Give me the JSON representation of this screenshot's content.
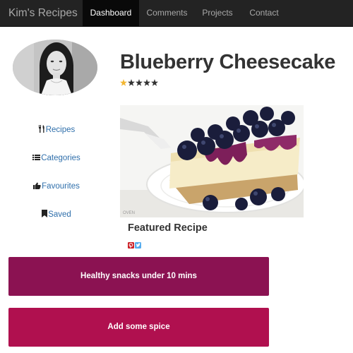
{
  "nav": {
    "brand": "Kim's Recipes",
    "items": [
      {
        "label": "Dashboard",
        "active": true
      },
      {
        "label": "Comments",
        "active": false
      },
      {
        "label": "Projects",
        "active": false
      },
      {
        "label": "Contact",
        "active": false
      }
    ]
  },
  "recipe": {
    "title": "Blueberry Cheesecake",
    "rating": 1,
    "rating_max": 5,
    "featured_label": "Featured Recipe",
    "watermark": "OVEN"
  },
  "sidebar": {
    "items": [
      {
        "label": "Recipes",
        "icon": "cutlery-icon"
      },
      {
        "label": "Categories",
        "icon": "list-icon"
      },
      {
        "label": "Favourites",
        "icon": "thumbs-up-icon"
      },
      {
        "label": "Saved",
        "icon": "bookmark-icon"
      }
    ]
  },
  "share": {
    "icons": [
      "pinterest-icon",
      "twitter-icon"
    ]
  },
  "buttons": [
    {
      "label": "Healthy snacks under 10 mins"
    },
    {
      "label": "Add some spice"
    }
  ],
  "colors": {
    "navbar": "#232323",
    "nav_active": "#090909",
    "link": "#337ab7",
    "button_1": "#8b1252",
    "button_2": "#b0104f",
    "star_filled": "#f2b632",
    "star_empty": "#333333",
    "pinterest": "#cb2027",
    "twitter": "#55acee"
  }
}
